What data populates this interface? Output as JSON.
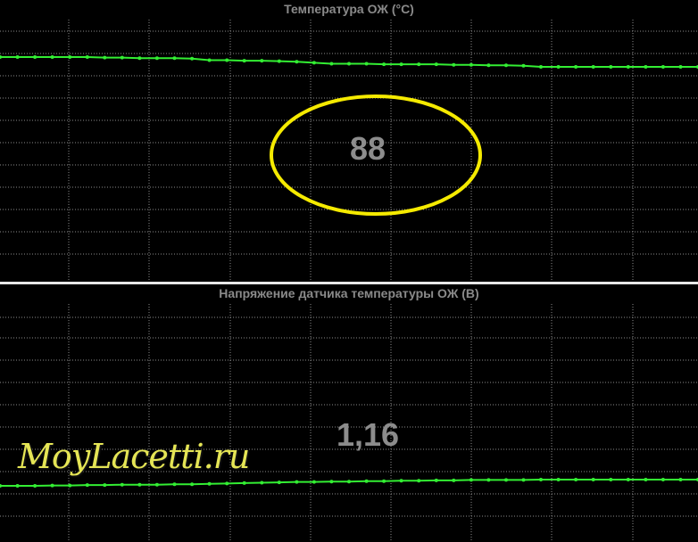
{
  "watermark": "MoyLacetti.ru",
  "colors": {
    "background": "#000000",
    "grid": "#8c8c8c",
    "line": "#33ee33",
    "text": "#8a8a8a",
    "highlight": "#f5ea00",
    "divider": "#e8e8e8"
  },
  "chart_data": [
    {
      "type": "line",
      "title": "Температура ОЖ  (°C)",
      "current_value": "88",
      "current_value_highlighted": true,
      "grid": true,
      "series": [
        {
          "values": [
            90.2,
            90.2,
            90.2,
            90.2,
            90.2,
            90.2,
            90.1,
            90.1,
            90.0,
            90.0,
            90.0,
            89.9,
            89.6,
            89.6,
            89.5,
            89.5,
            89.4,
            89.3,
            89.1,
            88.9,
            88.9,
            88.9,
            88.8,
            88.8,
            88.8,
            88.8,
            88.7,
            88.7,
            88.6,
            88.6,
            88.5,
            88.3,
            88.3,
            88.3,
            88.3,
            88.3,
            88.3,
            88.3,
            88.3,
            88.3,
            88.3
          ]
        }
      ]
    },
    {
      "type": "line",
      "title": "Напряжение датчика температуры ОЖ  (В)",
      "current_value": "1,16",
      "current_value_highlighted": false,
      "grid": true,
      "series": [
        {
          "values": [
            1.1,
            1.1,
            1.1,
            1.101,
            1.101,
            1.102,
            1.102,
            1.103,
            1.103,
            1.103,
            1.104,
            1.104,
            1.105,
            1.106,
            1.107,
            1.108,
            1.109,
            1.11,
            1.11,
            1.111,
            1.111,
            1.112,
            1.112,
            1.113,
            1.113,
            1.114,
            1.114,
            1.115,
            1.115,
            1.115,
            1.115,
            1.116,
            1.116,
            1.116,
            1.116,
            1.116,
            1.116,
            1.116,
            1.116,
            1.116,
            1.116
          ]
        }
      ]
    }
  ]
}
